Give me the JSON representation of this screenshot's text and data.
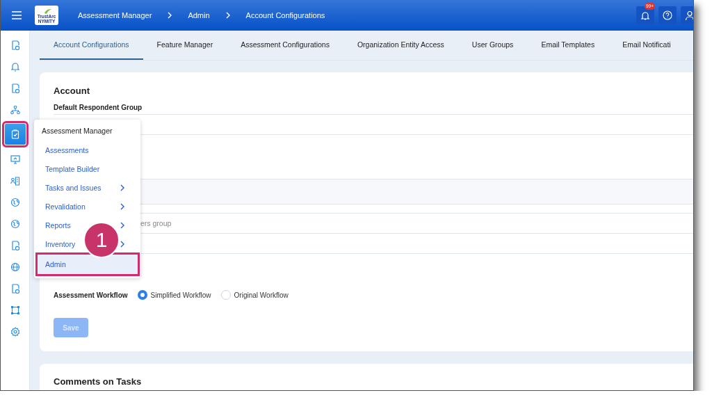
{
  "topbar": {
    "logo": {
      "line_1": "TrustArc",
      "line_2": "NYMITY"
    },
    "breadcrumbs": [
      "Assessment Manager",
      "Admin",
      "Account Configurations"
    ],
    "notification_badge": "99+"
  },
  "sidebar": {
    "items": [
      {
        "selected": false
      },
      {
        "selected": false
      },
      {
        "selected": false
      },
      {
        "selected": false
      },
      {
        "selected": true
      },
      {
        "selected": false
      },
      {
        "selected": false
      },
      {
        "selected": false
      },
      {
        "selected": false
      },
      {
        "selected": false
      },
      {
        "selected": false
      },
      {
        "selected": false
      },
      {
        "selected": false
      },
      {
        "selected": false
      }
    ]
  },
  "tabs": [
    {
      "label": "Account Configurations",
      "selected": true
    },
    {
      "label": "Feature Manager",
      "selected": false
    },
    {
      "label": "Assessment Configurations",
      "selected": false
    },
    {
      "label": "Organization Entity Access",
      "selected": false
    },
    {
      "label": "User Groups",
      "selected": false
    },
    {
      "label": "Email Templates",
      "selected": false
    },
    {
      "label": "Email Notificati",
      "selected": false
    }
  ],
  "account_card": {
    "title": "Account",
    "field_label": "Default Respondent Group",
    "rows": [
      {
        "kind": "field"
      },
      {
        "kind": "tall"
      },
      {
        "kind": "shaded"
      },
      {
        "kind": "field",
        "value": "ers group"
      },
      {
        "kind": "field"
      }
    ],
    "workflow": {
      "label": "Assessment Workflow",
      "options": [
        {
          "label": "Simplified Workflow",
          "selected": true
        },
        {
          "label": "Original Workflow",
          "selected": false
        }
      ]
    },
    "save_button": {
      "label": "Save",
      "disabled": true
    }
  },
  "comments_card": {
    "title": "Comments on Tasks"
  },
  "nav_menu": {
    "title": "Assessment Manager",
    "items": [
      {
        "label": "Assessments",
        "has_submenu": false,
        "selected": false
      },
      {
        "label": "Template Builder",
        "has_submenu": false,
        "selected": false
      },
      {
        "label": "Tasks and Issues",
        "has_submenu": true,
        "selected": false
      },
      {
        "label": "Revalidation",
        "has_submenu": true,
        "selected": false
      },
      {
        "label": "Reports",
        "has_submenu": true,
        "selected": false
      },
      {
        "label": "Inventory",
        "has_submenu": true,
        "selected": false
      },
      {
        "label": "Admin",
        "has_submenu": false,
        "selected": true
      }
    ]
  },
  "step_marker": "1"
}
